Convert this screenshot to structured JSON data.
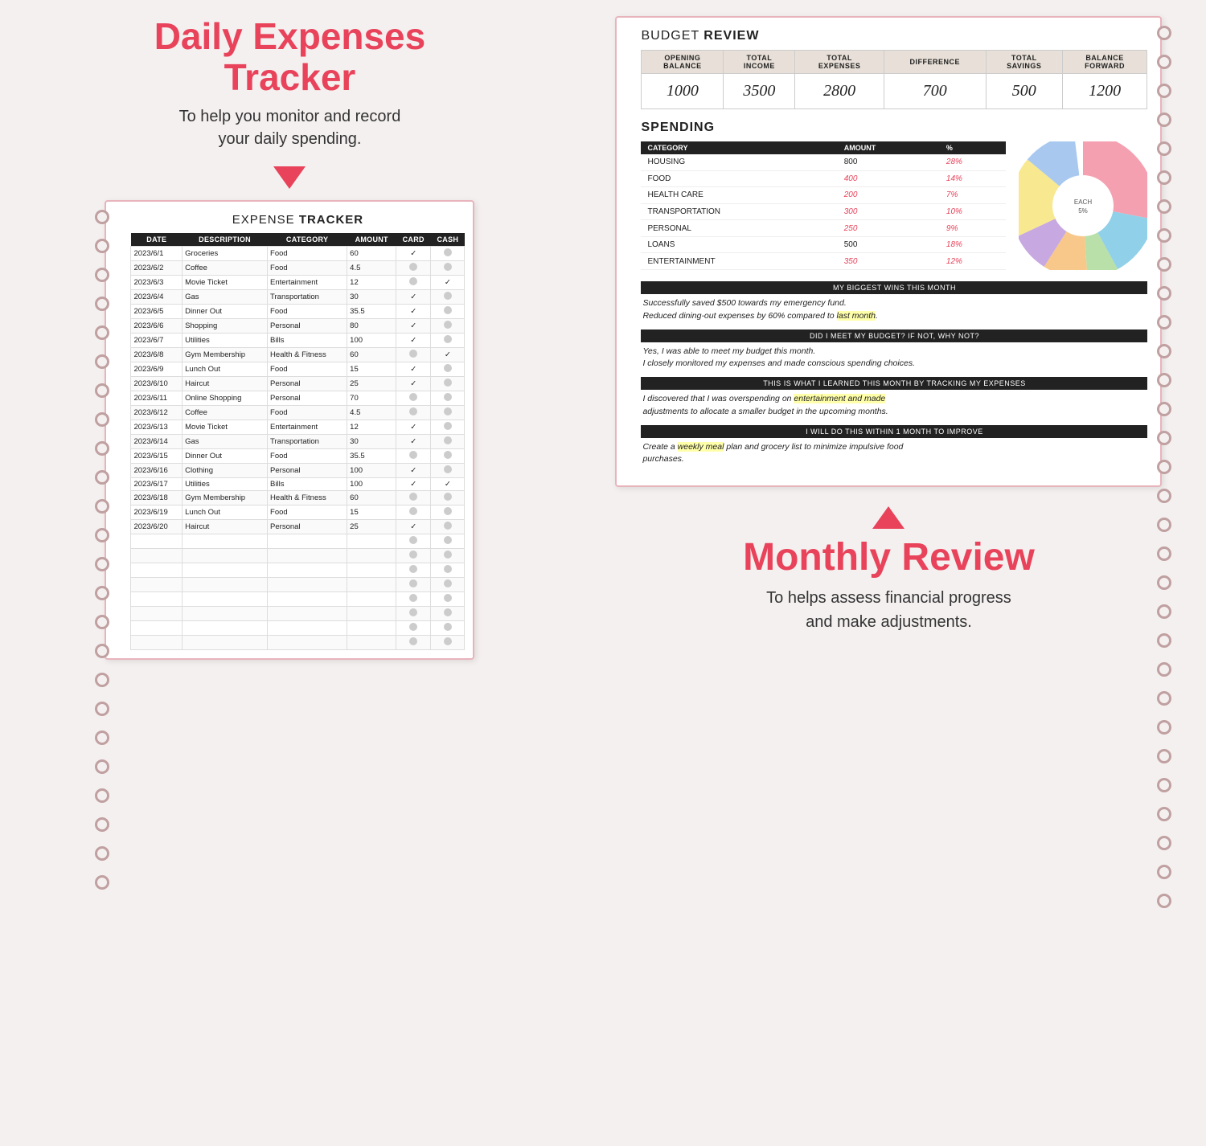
{
  "left": {
    "title_line1": "Daily Expenses",
    "title_line2": "Tracker",
    "subtitle": "To help you monitor and record\nyour daily spending.",
    "tracker_title": "EXPENSE ",
    "tracker_title_bold": "TRACKER",
    "table_headers": [
      "DATE",
      "DESCRIPTION",
      "CATEGORY",
      "AMOUNT",
      "CARD",
      "CASH"
    ],
    "rows": [
      {
        "date": "2023/6/1",
        "desc": "Groceries",
        "cat": "Food",
        "cat_class": "cat-food",
        "amount": "60",
        "card": true,
        "cash": false
      },
      {
        "date": "2023/6/2",
        "desc": "Coffee",
        "cat": "Food",
        "cat_class": "cat-food",
        "amount": "4.5",
        "card": false,
        "cash": false
      },
      {
        "date": "2023/6/3",
        "desc": "Movie Ticket",
        "cat": "Entertainment",
        "cat_class": "cat-entertainment",
        "amount": "12",
        "card": false,
        "cash": true
      },
      {
        "date": "2023/6/4",
        "desc": "Gas",
        "cat": "Transportation",
        "cat_class": "cat-transport",
        "amount": "30",
        "card": true,
        "cash": false
      },
      {
        "date": "2023/6/5",
        "desc": "Dinner Out",
        "cat": "Food",
        "cat_class": "cat-food",
        "amount": "35.5",
        "card": true,
        "cash": false
      },
      {
        "date": "2023/6/6",
        "desc": "Shopping",
        "cat": "Personal",
        "cat_class": "cat-personal",
        "amount": "80",
        "card": true,
        "cash": false
      },
      {
        "date": "2023/6/7",
        "desc": "Utilities",
        "cat": "Bills",
        "cat_class": "cat-bills",
        "amount": "100",
        "card": true,
        "cash": false
      },
      {
        "date": "2023/6/8",
        "desc": "Gym Membership",
        "cat": "Health & Fitness",
        "cat_class": "cat-health",
        "amount": "60",
        "card": false,
        "cash": true
      },
      {
        "date": "2023/6/9",
        "desc": "Lunch Out",
        "cat": "Food",
        "cat_class": "cat-food",
        "amount": "15",
        "card": true,
        "cash": false
      },
      {
        "date": "2023/6/10",
        "desc": "Haircut",
        "cat": "Personal",
        "cat_class": "cat-personal",
        "amount": "25",
        "card": true,
        "cash": false
      },
      {
        "date": "2023/6/11",
        "desc": "Online Shopping",
        "cat": "Personal",
        "cat_class": "cat-personal",
        "amount": "70",
        "card": false,
        "cash": false
      },
      {
        "date": "2023/6/12",
        "desc": "Coffee",
        "cat": "Food",
        "cat_class": "cat-food",
        "amount": "4.5",
        "card": false,
        "cash": false
      },
      {
        "date": "2023/6/13",
        "desc": "Movie Ticket",
        "cat": "Entertainment",
        "cat_class": "cat-entertainment",
        "amount": "12",
        "card": true,
        "cash": false
      },
      {
        "date": "2023/6/14",
        "desc": "Gas",
        "cat": "Transportation",
        "cat_class": "cat-transport",
        "amount": "30",
        "card": true,
        "cash": false
      },
      {
        "date": "2023/6/15",
        "desc": "Dinner Out",
        "cat": "Food",
        "cat_class": "cat-food",
        "amount": "35.5",
        "card": false,
        "cash": false
      },
      {
        "date": "2023/6/16",
        "desc": "Clothing",
        "cat": "Personal",
        "cat_class": "cat-personal",
        "amount": "100",
        "card": true,
        "cash": false
      },
      {
        "date": "2023/6/17",
        "desc": "Utilities",
        "cat": "Bills",
        "cat_class": "cat-bills",
        "amount": "100",
        "card": true,
        "cash": true
      },
      {
        "date": "2023/6/18",
        "desc": "Gym Membership",
        "cat": "Health & Fitness",
        "cat_class": "cat-health",
        "amount": "60",
        "card": false,
        "cash": false
      },
      {
        "date": "2023/6/19",
        "desc": "Lunch Out",
        "cat": "Food",
        "cat_class": "cat-food",
        "amount": "15",
        "card": false,
        "cash": false
      },
      {
        "date": "2023/6/20",
        "desc": "Haircut",
        "cat": "Personal",
        "cat_class": "cat-personal",
        "amount": "25",
        "card": true,
        "cash": false
      }
    ],
    "empty_rows": 8
  },
  "right": {
    "budget_review_label": "BUDGET ",
    "budget_review_bold": "REVIEW",
    "budget_headers": [
      "OPENING\nBALANCE",
      "TOTAL\nINCOME",
      "TOTAL\nEXPENSES",
      "DIFFERENCE",
      "TOTAL\nSAVINGS",
      "BALANCE\nFORWARD"
    ],
    "budget_values": [
      "1000",
      "3500",
      "2800",
      "700",
      "500",
      "1200"
    ],
    "spending_label": "SPENDING",
    "spending_headers": [
      "CATEGORY",
      "AMOUNT",
      "%"
    ],
    "spending_rows": [
      {
        "cat": "HOUSING",
        "amount": "800",
        "pct": "28%",
        "amount_dark": true,
        "pct_dark": false
      },
      {
        "cat": "FOOD",
        "amount": "400",
        "pct": "14%",
        "amount_dark": false,
        "pct_dark": false
      },
      {
        "cat": "HEALTH CARE",
        "amount": "200",
        "pct": "7%",
        "amount_dark": false,
        "pct_dark": false
      },
      {
        "cat": "TRANSPORTATION",
        "amount": "300",
        "pct": "10%",
        "amount_dark": false,
        "pct_dark": false
      },
      {
        "cat": "PERSONAL",
        "amount": "250",
        "pct": "9%",
        "amount_dark": false,
        "pct_dark": false
      },
      {
        "cat": "LOANS",
        "amount": "500",
        "pct": "18%",
        "amount_dark": true,
        "pct_dark": false
      },
      {
        "cat": "ENTERTAINMENT",
        "amount": "350",
        "pct": "12%",
        "amount_dark": false,
        "pct_dark": false
      }
    ],
    "pie_center": "EACH\n5%",
    "sections": [
      {
        "header": "MY BIGGEST WINS THIS MONTH",
        "lines": [
          {
            "text": "Successfully saved $500 towards my emergency fund.",
            "highlight": ""
          },
          {
            "text": "Reduced dining-out expenses by 60% compared to last month.",
            "highlight": "last month"
          }
        ]
      },
      {
        "header": "DID I MEET MY BUDGET? IF NOT, WHY NOT?",
        "lines": [
          {
            "text": "Yes, I was able to meet my budget this month.",
            "highlight": ""
          },
          {
            "text": "I closely monitored my expenses and made conscious spending choices.",
            "highlight": ""
          }
        ]
      },
      {
        "header": "THIS IS WHAT I LEARNED THIS MONTH BY TRACKING MY EXPENSES",
        "lines": [
          {
            "text": "I discovered that I was overspending on entertainment and made",
            "highlight": "entertainment and made"
          },
          {
            "text": "adjustments to allocate a smaller budget in the upcoming months.",
            "highlight": ""
          }
        ]
      },
      {
        "header": "I WILL DO THIS WITHIN 1 MONTH TO IMPROVE",
        "lines": [
          {
            "text": "Create a weekly meal plan and grocery list to minimize impulsive food",
            "highlight": "weekly meal"
          },
          {
            "text": "purchases.",
            "highlight": ""
          }
        ]
      }
    ]
  },
  "bottom": {
    "monthly_review_title": "Monthly Review",
    "monthly_review_sub_line1": "To helps assess financial progress",
    "monthly_review_sub_line2": "and make adjustments."
  }
}
